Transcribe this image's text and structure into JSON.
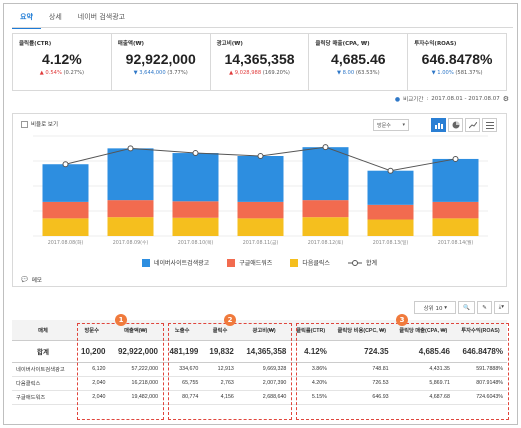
{
  "tabs": [
    "요약",
    "상세",
    "네이버 검색광고"
  ],
  "kpis": [
    {
      "label": "클릭률(CTR)",
      "value": "4.12%",
      "dir": "up",
      "change": "0.54%",
      "pct": "(0.27%)"
    },
    {
      "label": "매출액(₩)",
      "value": "92,922,000",
      "dir": "down",
      "change": "3,644,000",
      "pct": "(3.77%)"
    },
    {
      "label": "광고비(₩)",
      "value": "14,365,358",
      "dir": "up",
      "change": "9,028,988",
      "pct": "(169.20%)"
    },
    {
      "label": "클릭당 매출(CPA, ₩)",
      "value": "4,685.46",
      "dir": "down",
      "change": "8.00",
      "pct": "(63.53%)"
    },
    {
      "label": "투자수익(ROAS)",
      "value": "646.8478%",
      "dir": "down",
      "change": "1.00%",
      "pct": "(581.37%)"
    }
  ],
  "period": {
    "label": "비교기간",
    "range": "2017.08.01 - 2017.08.07"
  },
  "chart_controls": {
    "ratio_label": "비율로 보기",
    "select_value": "방문수"
  },
  "colors": {
    "naver": "#2d8ee0",
    "google": "#f26b4f",
    "daum": "#f5bf1e",
    "total": "#555555",
    "accent": "#2a7fd4",
    "badge": "#f07a3c"
  },
  "chart_data": {
    "type": "bar",
    "stacked": true,
    "categories": [
      "2017.08.08(화)",
      "2017.08.09(수)",
      "2017.08.10(목)",
      "2017.08.11(금)",
      "2017.08.12(토)",
      "2017.08.13(일)",
      "2017.08.14(월)"
    ],
    "series": [
      {
        "name": "네이버사이트검색광고",
        "values": [
          640,
          880,
          820,
          780,
          900,
          580,
          730
        ]
      },
      {
        "name": "구글애드워즈",
        "values": [
          280,
          290,
          280,
          280,
          290,
          250,
          280
        ]
      },
      {
        "name": "다음클릭스",
        "values": [
          300,
          320,
          310,
          300,
          320,
          280,
          300
        ]
      }
    ],
    "line": {
      "name": "합계",
      "values": [
        1220,
        1490,
        1410,
        1360,
        1510,
        1110,
        1310
      ]
    },
    "ylim": [
      0,
      1700
    ],
    "legend_position": "bottom",
    "grid": true
  },
  "memo_label": "메모",
  "table_tools": {
    "rows_label": "상위 10"
  },
  "table": {
    "headers": [
      "매체",
      "방문수",
      "매출액(₩)",
      "노출수",
      "클릭수",
      "광고비(₩)",
      "클릭률(CTR)",
      "클릭당 비용(CPC, ₩)",
      "클릭당 매출(CPA, ₩)",
      "투자수익(ROAS)"
    ],
    "total": [
      "합계",
      "10,200",
      "92,922,000",
      "481,199",
      "19,832",
      "14,365,358",
      "4.12%",
      "724.35",
      "4,685.46",
      "646.8478%"
    ],
    "rows": [
      [
        "네이버사이트검색광고",
        "6,120",
        "57,222,000",
        "334,670",
        "12,913",
        "9,669,328",
        "3.86%",
        "748.81",
        "4,431.35",
        "591.7888%"
      ],
      [
        "다음클릭스",
        "2,040",
        "16,218,000",
        "65,755",
        "2,763",
        "2,007,390",
        "4.20%",
        "726.53",
        "5,869.71",
        "807.9148%"
      ],
      [
        "구글애드워즈",
        "2,040",
        "19,482,000",
        "80,774",
        "4,156",
        "2,688,640",
        "5.15%",
        "646.93",
        "4,687.68",
        "724.6043%"
      ]
    ]
  },
  "badges": [
    "1",
    "2",
    "3"
  ]
}
